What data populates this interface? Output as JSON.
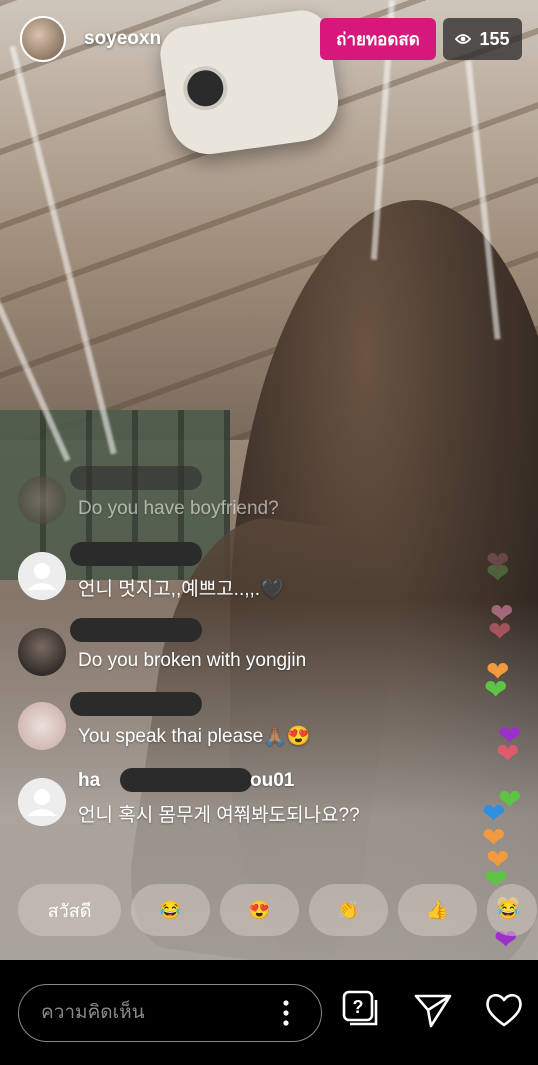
{
  "header": {
    "username": "soyeoxn",
    "live_label": "ถ่ายทอดสด",
    "viewer_count": "155",
    "eye_icon": "eye-icon"
  },
  "comments": [
    {
      "user": "",
      "text": "Do you have boyfriend?",
      "faded": true
    },
    {
      "user": "",
      "text": "언니 멋지고,,예쁘고..,,.🖤"
    },
    {
      "user": "",
      "text": "Do you broken with yongjin"
    },
    {
      "user": "",
      "text": "You speak thai please🙏🏽😍"
    },
    {
      "user_prefix": "ha",
      "user_suffix": "ou01",
      "text": "언니 혹시 몸무게 여쭤봐도되나요??"
    }
  ],
  "quick_reactions": [
    "สวัสดี",
    "😂",
    "😍",
    "👏",
    "👍",
    "😂"
  ],
  "comment_box": {
    "placeholder": "ความคิดเห็น"
  },
  "icons": [
    "more-options-icon",
    "question-box-icon",
    "send-icon",
    "heart-icon"
  ],
  "colors": {
    "live_badge": "#d6187b",
    "bottom_bar": "#000000"
  }
}
